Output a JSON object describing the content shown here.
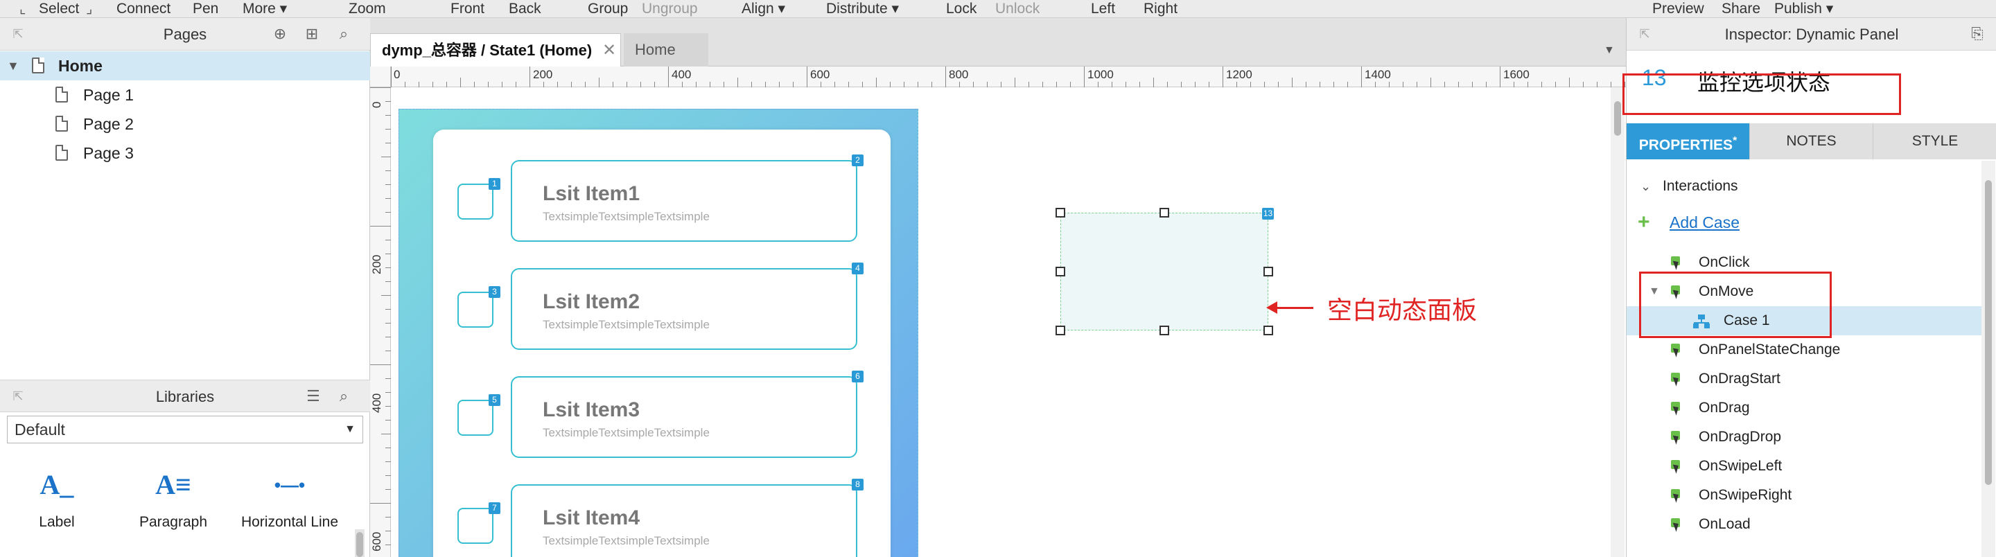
{
  "toolbar": {
    "select": "Select",
    "connect": "Connect",
    "pen": "Pen",
    "more": "More ▾",
    "zoom": "Zoom",
    "front": "Front",
    "back": "Back",
    "group": "Group",
    "ungroup": "Ungroup",
    "align": "Align ▾",
    "distribute": "Distribute ▾",
    "lock": "Lock",
    "unlock": "Unlock",
    "left": "Left",
    "right": "Right",
    "preview": "Preview",
    "share": "Share",
    "publish": "Publish ▾"
  },
  "pages": {
    "title": "Pages",
    "home": "Home",
    "items": [
      "Page 1",
      "Page 2",
      "Page 3"
    ]
  },
  "libraries": {
    "title": "Libraries",
    "selected": "Default",
    "widgets": [
      {
        "label": "Label",
        "glyph": "A_"
      },
      {
        "label": "Paragraph",
        "glyph": "A≡"
      },
      {
        "label": "Horizontal Line",
        "glyph": "•—•"
      }
    ]
  },
  "tabs": {
    "active": "dymp_总容器 / State1 (Home)",
    "inactive": "Home",
    "close": "✕"
  },
  "ruler": {
    "h": [
      "0",
      "200",
      "400",
      "600",
      "800",
      "1000",
      "1200",
      "1400",
      "1600"
    ],
    "v": [
      "0",
      "200",
      "400",
      "600"
    ]
  },
  "canvas": {
    "items": [
      {
        "title": "Lsit Item1",
        "sub": "TextsimpleTextsimpleTextsimple",
        "cb_badge": "1",
        "card_badge": "2"
      },
      {
        "title": "Lsit Item2",
        "sub": "TextsimpleTextsimpleTextsimple",
        "cb_badge": "3",
        "card_badge": "4"
      },
      {
        "title": "Lsit Item3",
        "sub": "TextsimpleTextsimpleTextsimple",
        "cb_badge": "5",
        "card_badge": "6"
      },
      {
        "title": "Lsit Item4",
        "sub": "TextsimpleTextsimpleTextsimple",
        "cb_badge": "7",
        "card_badge": "8"
      }
    ],
    "empty_panel_badge": "13",
    "annotation": "空白动态面板"
  },
  "inspector": {
    "title": "Inspector: Dynamic Panel",
    "widget_id": "13",
    "widget_name": "监控选项状态",
    "tabs": [
      "PROPERTIES",
      "NOTES",
      "STYLE"
    ],
    "properties_marker": "*",
    "section": "Interactions",
    "add_case": "Add Case",
    "events": [
      "OnClick",
      "OnMove",
      "OnPanelStateChange",
      "OnDragStart",
      "OnDrag",
      "OnDragDrop",
      "OnSwipeLeft",
      "OnSwipeRight",
      "OnLoad"
    ],
    "case": "Case 1"
  },
  "colors": {
    "accent": "#2e9ad8",
    "annotation": "#e02323",
    "item_border": "#35bfd0"
  }
}
